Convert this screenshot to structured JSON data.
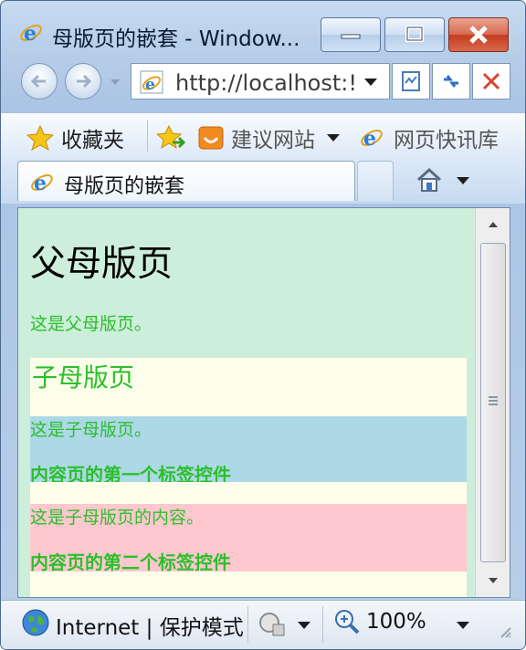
{
  "window": {
    "title": "母版页的嵌套 - Window..."
  },
  "navigation": {
    "address": "http://localhost:!"
  },
  "favorites_bar": {
    "favorites_label": "收藏夹",
    "suggested_sites_label": "建议网站",
    "web_slice_label": "网页快讯库"
  },
  "tab": {
    "title": "母版页的嵌套"
  },
  "page": {
    "parent_heading": "父母版页",
    "parent_text": "这是父母版页。",
    "child_heading": "子母版页",
    "child_text": "这是子母版页。",
    "label_control_1": "内容页的第一个标签控件",
    "child_content_text": "这是子母版页的内容。",
    "label_control_2": "内容页的第二个标签控件"
  },
  "colors": {
    "outer_background": "#cdeedb",
    "child_background": "#fcfeea",
    "band_blue": "#add8e6",
    "band_pink": "#ffc8cf",
    "green_text": "#2bbf2b"
  },
  "status_bar": {
    "zone": "Internet | 保护模式",
    "zoom": "100%"
  },
  "icons": {
    "ie": "ie-logo-icon",
    "favorites": "star-icon",
    "add_favorite": "add-favorite-icon",
    "suggested": "suggested-sites-icon",
    "home": "home-icon",
    "zoom": "zoom-icon",
    "globe": "globe-icon"
  }
}
